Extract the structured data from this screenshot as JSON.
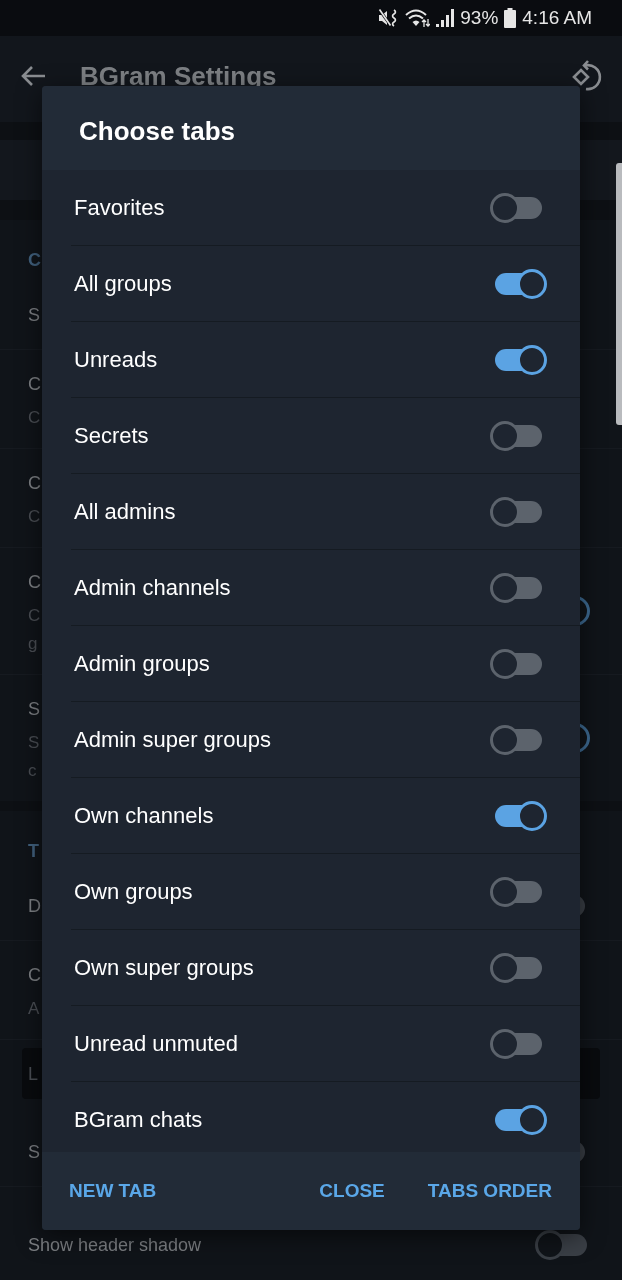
{
  "status_bar": {
    "battery": "93%",
    "time": "4:16 AM"
  },
  "app_bar": {
    "title": "BGram Settings"
  },
  "settings": [
    {
      "header": "C",
      "items": [
        {
          "kind": "row",
          "title": "S"
        },
        {
          "kind": "row",
          "title": "C",
          "subtitle": [
            "C"
          ]
        },
        {
          "kind": "row",
          "title": "C",
          "subtitle": [
            "C"
          ]
        },
        {
          "kind": "row",
          "title": "C",
          "subtitle": [
            "C",
            "g"
          ],
          "on": true
        },
        {
          "kind": "row",
          "title": "S",
          "subtitle": [
            "S",
            "c"
          ],
          "on": true
        }
      ]
    },
    {
      "header": "T",
      "items": [
        {
          "kind": "row",
          "title": "D",
          "on": false
        },
        {
          "kind": "row",
          "title": "C",
          "subtitle": [
            "A"
          ]
        },
        {
          "kind": "box",
          "text": "L"
        },
        {
          "kind": "row",
          "title": "S",
          "on": false
        },
        {
          "kind": "row",
          "title": "Show header shadow",
          "on": false
        }
      ]
    }
  ],
  "dialog": {
    "title": "Choose tabs",
    "options": [
      {
        "label": "Favorites",
        "on": false
      },
      {
        "label": "All groups",
        "on": true
      },
      {
        "label": "Unreads",
        "on": true
      },
      {
        "label": "Secrets",
        "on": false
      },
      {
        "label": "All admins",
        "on": false
      },
      {
        "label": "Admin channels",
        "on": false
      },
      {
        "label": "Admin groups",
        "on": false
      },
      {
        "label": "Admin super groups",
        "on": false
      },
      {
        "label": "Own channels",
        "on": true
      },
      {
        "label": "Own groups",
        "on": false
      },
      {
        "label": "Own super groups",
        "on": false
      },
      {
        "label": "Unread unmuted",
        "on": false
      },
      {
        "label": "BGram chats",
        "on": true
      }
    ],
    "buttons": [
      "NEW TAB",
      "CLOSE",
      "TABS ORDER"
    ]
  }
}
